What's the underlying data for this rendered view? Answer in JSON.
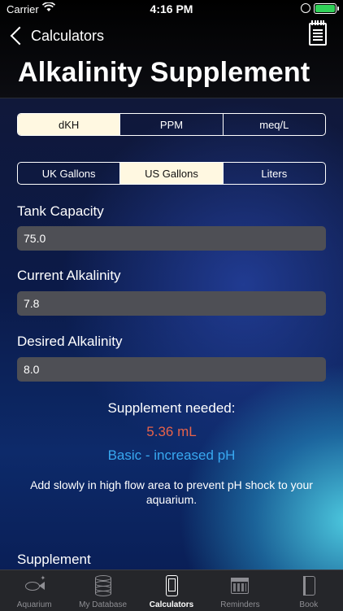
{
  "status_bar": {
    "carrier": "Carrier",
    "time": "4:16 PM"
  },
  "nav": {
    "back_label": "Calculators"
  },
  "page_title": "Alkalinity Supplement",
  "units_segment": {
    "options": [
      "dKH",
      "PPM",
      "meq/L"
    ],
    "selected": "dKH"
  },
  "volume_segment": {
    "options": [
      "UK Gallons",
      "US Gallons",
      "Liters"
    ],
    "selected": "US Gallons"
  },
  "fields": {
    "tank_capacity": {
      "label": "Tank Capacity",
      "value": "75.0"
    },
    "current_alkalinity": {
      "label": "Current Alkalinity",
      "value": "7.8"
    },
    "desired_alkalinity": {
      "label": "Desired Alkalinity",
      "value": "8.0"
    }
  },
  "result": {
    "title": "Supplement needed:",
    "amount": "5.36 mL",
    "type": "Basic - increased pH",
    "note": "Add slowly in high flow area to prevent pH shock to your aquarium."
  },
  "supplement_label": "Supplement",
  "tabbar": {
    "tabs": [
      {
        "label": "Aquarium",
        "icon": "fish-icon"
      },
      {
        "label": "My Database",
        "icon": "database-icon"
      },
      {
        "label": "Calculators",
        "icon": "phone-icon"
      },
      {
        "label": "Reminders",
        "icon": "calendar-icon"
      },
      {
        "label": "Book",
        "icon": "book-icon"
      }
    ],
    "active": "Calculators"
  },
  "colors": {
    "amount": "#e7624a",
    "type": "#38a8f0",
    "selected_segment": "#fff8e1"
  }
}
